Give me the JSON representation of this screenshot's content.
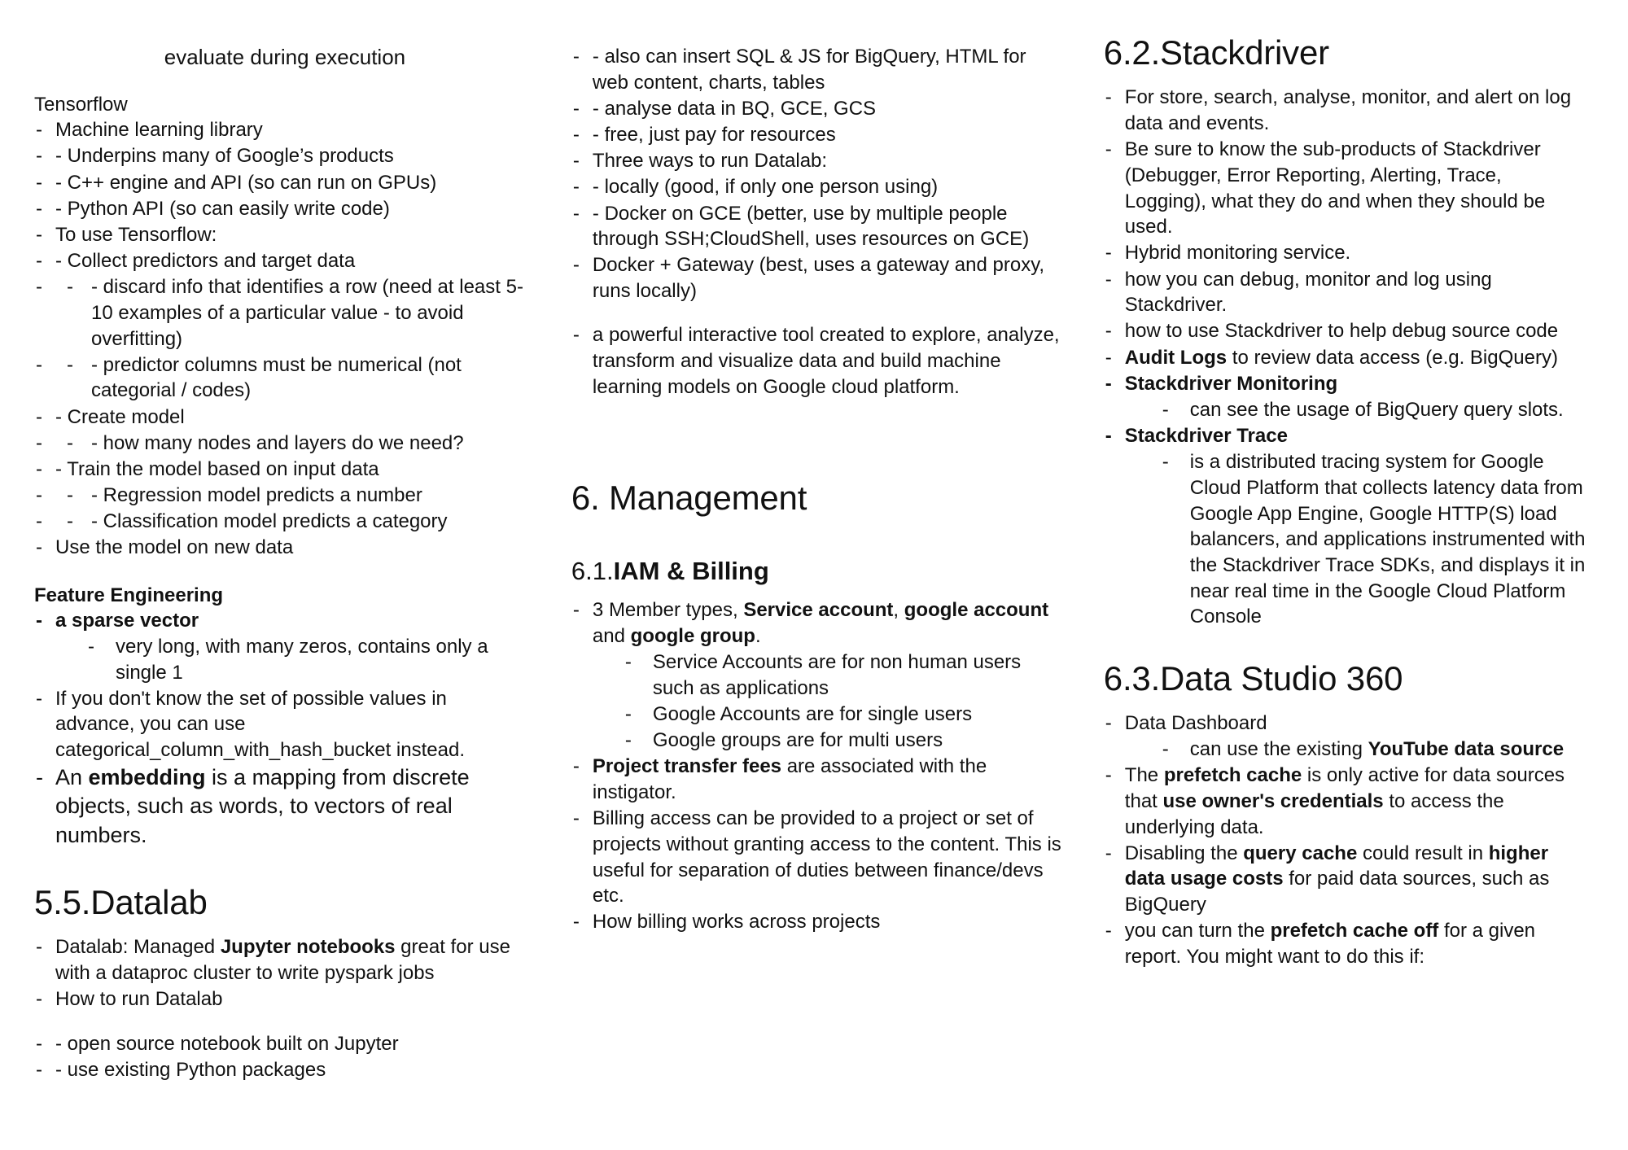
{
  "document": {
    "heading_top": "evaluate during execution",
    "col1": {
      "tensorflow_title": "Tensorflow",
      "tensorflow_items": [
        {
          "level": 0,
          "text": "Machine learning library"
        },
        {
          "level": 1,
          "text": "- Underpins many of Google’s products"
        },
        {
          "level": 1,
          "text": "- C++ engine and API (so can run on GPUs)"
        },
        {
          "level": 1,
          "text": "- Python API (so can easily write code)"
        },
        {
          "level": 0,
          "text": "To use Tensorflow:"
        },
        {
          "level": 1,
          "text": "- Collect predictors and target data"
        },
        {
          "level": 2,
          "text": "- discard info that identifies a row (need at least 5-10 examples of a particular value - to avoid overfitting)"
        },
        {
          "level": 2,
          "text": "- predictor columns must be numerical (not categorial / codes)"
        },
        {
          "level": 1,
          "text": "- Create model"
        },
        {
          "level": 2,
          "text": "- how many nodes and layers do we need?"
        },
        {
          "level": 1,
          "text": "- Train the model based on input data"
        },
        {
          "level": 2,
          "text": "- Regression model predicts a number"
        },
        {
          "level": 2,
          "text": "- Classification model predicts a category"
        },
        {
          "level": 0,
          "text": "Use the model on new data"
        }
      ],
      "feature_engineering_title": "Feature Engineering",
      "sparse_vector_label": "a sparse vector",
      "sparse_vector_detail": "very long, with many zeros, contains only a single 1",
      "hash_bucket_bullet": "If you don't know the set of possible values in advance, you can use categorical_column_with_hash_bucket instead.",
      "embedding_bullet": {
        "before": "An ",
        "bold": "embedding",
        "after": " is a mapping from discrete objects, such as words, to vectors of real numbers."
      },
      "datalab_heading": "5.5.Datalab",
      "datalab_items": [
        {
          "level": 0,
          "before": "Datalab: Managed ",
          "bold": "Jupyter notebooks",
          "after": " great for use with a dataproc cluster to write pyspark jobs"
        },
        {
          "level": 0,
          "text": "How to run Datalab"
        }
      ],
      "datalab_items_2": [
        {
          "level": 1,
          "text": "- open source notebook built on Jupyter"
        },
        {
          "level": 1,
          "text": "- use existing Python packages"
        }
      ]
    },
    "col2": {
      "datalab_continued": [
        {
          "level": 1,
          "text": "- also can insert SQL & JS for BigQuery, HTML for web content, charts, tables"
        },
        {
          "level": 1,
          "text": "- analyse data in BQ, GCE, GCS"
        },
        {
          "level": 1,
          "text": "- free, just pay for resources"
        },
        {
          "level": 0,
          "text": "Three ways to run Datalab:"
        },
        {
          "level": 1,
          "text": "- locally (good, if only one person using)"
        },
        {
          "level": 1,
          "text": "- Docker on GCE (better, use by multiple people through SSH;CloudShell, uses resources on GCE)"
        },
        {
          "level": 0,
          "text": "Docker + Gateway (best, uses a gateway and proxy, runs locally)"
        }
      ],
      "powerful_tool": "a powerful interactive tool created to explore, analyze, transform and visualize data and build machine learning models on Google cloud platform.",
      "management_heading": "6. Management",
      "iam_heading_number": "6.1.",
      "iam_heading_title": "IAM & Billing",
      "iam_member_types": {
        "before": "3 Member types, ",
        "bold1": "Service account",
        "mid1": ", ",
        "bold2": "google account",
        "mid2": " and ",
        "bold3": "google group",
        "after": "."
      },
      "iam_sub_items": [
        {
          "text": "Service Accounts are for non human users such as applications"
        },
        {
          "text": "Google Accounts are for single users"
        },
        {
          "text": "Google groups are for multi users"
        }
      ],
      "project_transfer": {
        "bold": "Project transfer fees",
        "after": " are associated with the instigator."
      },
      "billing_access": "Billing access can be provided to a project or set of projects without granting access to the content. This is useful for separation of duties between finance/devs etc.",
      "how_billing_works": "How billing works across projects"
    },
    "col3": {
      "stackdriver_heading": "6.2.Stackdriver",
      "stackdriver_items": [
        {
          "level": 0,
          "text": "For store, search, analyse, monitor, and alert on log data and events."
        },
        {
          "level": 0,
          "text": "Be sure to know the sub-products of Stackdriver (Debugger, Error Reporting, Alerting, Trace, Logging), what they do and when they should be used."
        },
        {
          "level": 0,
          "text": "Hybrid monitoring service."
        },
        {
          "level": 0,
          "text": "how you can debug, monitor and log using Stackdriver."
        },
        {
          "level": 0,
          "text": "how to use Stackdriver to help debug source code"
        }
      ],
      "audit_logs": {
        "bold": "Audit Logs",
        "after": " to review data access (e.g. BigQuery)"
      },
      "monitoring_label": "Stackdriver Monitoring",
      "monitoring_detail": "can see the usage of BigQuery query slots.",
      "trace_label": "Stackdriver Trace",
      "trace_detail": " is a distributed tracing system for Google Cloud Platform that collects latency data from Google App Engine, Google HTTP(S) load balancers, and applications instrumented with the Stackdriver Trace SDKs, and displays it in near real time in the Google Cloud Platform Console",
      "datastudio_heading": "6.3.Data Studio 360",
      "data_dashboard": "Data Dashboard",
      "youtube_source": {
        "before": "can use the existing ",
        "bold": "YouTube data source"
      },
      "prefetch_cache": {
        "before": "The ",
        "bold1": "prefetch cache",
        "mid": " is only active for data sources that ",
        "bold2": "use owner's credentials",
        "after": " to access the underlying data."
      },
      "query_cache": {
        "before": "Disabling the ",
        "bold1": "query cache",
        "mid": " could result in ",
        "bold2": "higher data usage costs",
        "after": " for paid data sources, such as BigQuery"
      },
      "prefetch_off": {
        "before": "you can turn the ",
        "bold": "prefetch cache off",
        "after": " for a given report. You might want to do this if:"
      }
    }
  }
}
